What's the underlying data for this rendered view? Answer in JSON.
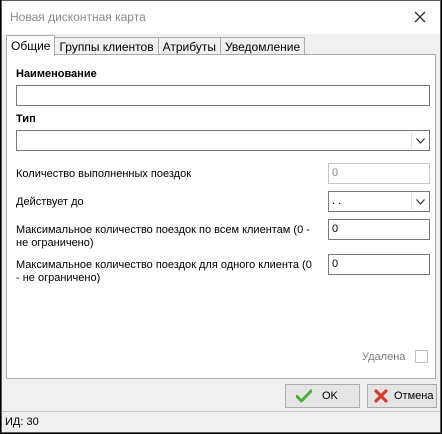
{
  "window": {
    "title": "Новая дисконтная карта"
  },
  "tabs": [
    {
      "label": "Общие",
      "active": true
    },
    {
      "label": "Группы клиентов",
      "active": false
    },
    {
      "label": "Атрибуты",
      "active": false
    },
    {
      "label": "Уведомление",
      "active": false
    }
  ],
  "form": {
    "name_label": "Наименование",
    "name_value": "",
    "type_label": "Тип",
    "type_value": "",
    "trips_done_label": "Количество выполненных поездок",
    "trips_done_value": "0",
    "valid_until_label": "Действует до",
    "valid_until_value": " .  .",
    "max_all_label": "Максимальное количество поездок по всем клиентам (0 - не ограничено)",
    "max_all_value": "0",
    "max_one_label": "Максимальное количество поездок для одного клиента (0 - не ограничено)",
    "max_one_value": "0",
    "deleted_label": "Удалена",
    "deleted_checked": false
  },
  "buttons": {
    "ok_label": "OK",
    "cancel_label": "Отмена"
  },
  "status": {
    "id_text": "ИД: 30"
  },
  "colors": {
    "ok_check": "#4caf3a",
    "cancel_x": "#d93b2b"
  },
  "icons": {
    "close": "close-icon",
    "dropdown": "chevron-down-icon",
    "ok": "checkmark-icon",
    "cancel": "cancel-x-icon"
  }
}
